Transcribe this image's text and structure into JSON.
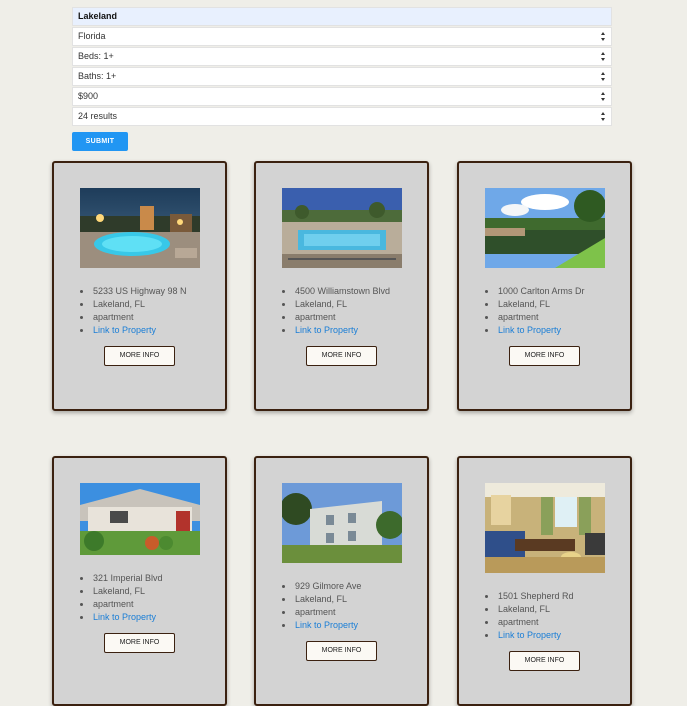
{
  "search": {
    "city": "Lakeland",
    "state": "Florida",
    "beds": "Beds: 1+",
    "baths": "Baths: 1+",
    "price": "$900",
    "results": "24 results",
    "submit_label": "SUBMIT"
  },
  "listings": [
    {
      "address": "5233 US Highway 98 N",
      "city": "Lakeland, FL",
      "type": "apartment",
      "link": "Link to Property",
      "more": "MORE INFO"
    },
    {
      "address": "4500 Williamstown Blvd",
      "city": "Lakeland, FL",
      "type": "apartment",
      "link": "Link to Property",
      "more": "MORE INFO"
    },
    {
      "address": "1000 Carlton Arms Dr",
      "city": "Lakeland, FL",
      "type": "apartment",
      "link": "Link to Property",
      "more": "MORE INFO"
    },
    {
      "address": "321 Imperial Blvd",
      "city": "Lakeland, FL",
      "type": "apartment",
      "link": "Link to Property",
      "more": "MORE INFO"
    },
    {
      "address": "929 Gilmore Ave",
      "city": "Lakeland, FL",
      "type": "apartment",
      "link": "Link to Property",
      "more": "MORE INFO"
    },
    {
      "address": "1501 Shepherd Rd",
      "city": "Lakeland, FL",
      "type": "apartment",
      "link": "Link to Property",
      "more": "MORE INFO"
    }
  ],
  "colors": {
    "page_bg": "#efeee8",
    "card_bg": "#d3d3d3",
    "card_border": "#3b2110",
    "accent": "#2196f3",
    "link": "#1a7ed6"
  }
}
